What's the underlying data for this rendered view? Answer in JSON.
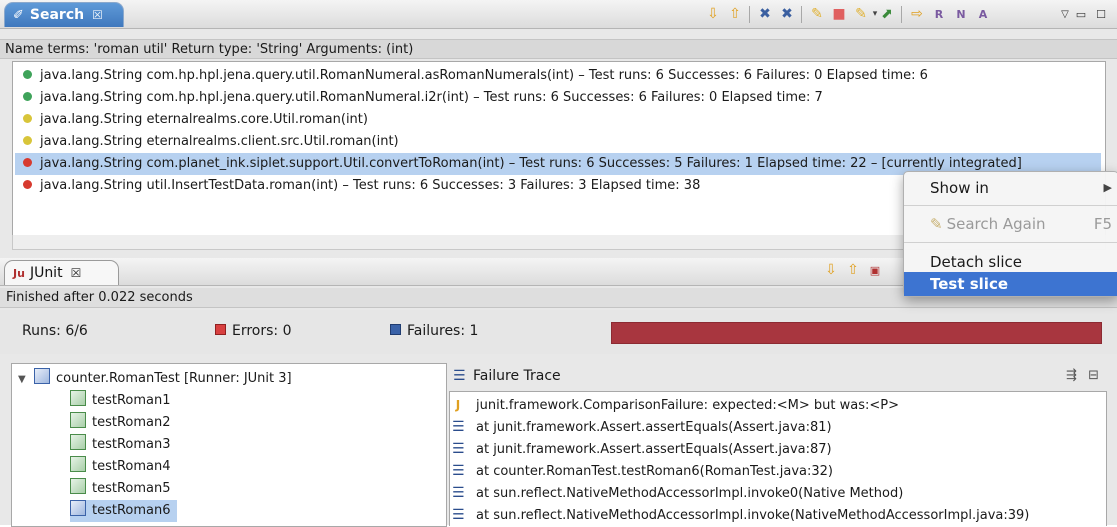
{
  "search_view": {
    "tab_label": "Search",
    "tab_close": "☒",
    "status": "Name terms: 'roman util' Return type: 'String' Arguments: (int)",
    "results": [
      {
        "text": "java.lang.String com.hp.hpl.jena.query.util.RomanNumeral.asRomanNumerals(int) – Test runs: 6 Successes: 6 Failures: 0 Elapsed time: 6",
        "status_color": "#3fa35a"
      },
      {
        "text": "java.lang.String com.hp.hpl.jena.query.util.RomanNumeral.i2r(int) – Test runs: 6 Successes: 6 Failures: 0 Elapsed time: 7",
        "status_color": "#3fa35a"
      },
      {
        "text": "java.lang.String eternalrealms.core.Util.roman(int)",
        "status_color": "#d8c53a"
      },
      {
        "text": "java.lang.String eternalrealms.client.src.Util.roman(int)",
        "status_color": "#d8c53a"
      },
      {
        "text": "java.lang.String com.planet_ink.siplet.support.Util.convertToRoman(int) – Test runs: 6 Successes: 5 Failures: 1 Elapsed time: 22 – [currently integrated]",
        "status_color": "#d73a2f"
      },
      {
        "text": "java.lang.String util.InsertTestData.roman(int) – Test runs: 6 Successes: 3 Failures: 3 Elapsed time: 38",
        "status_color": "#d73a2f"
      }
    ],
    "toolbar_icons": [
      "arrow-down-icon",
      "arrow-up-icon",
      "remove-icon",
      "remove-all-icon",
      "search-again-icon",
      "stop-icon",
      "history-icon",
      "pin-icon",
      "forward-icon",
      "filter-r-icon",
      "filter-n-icon",
      "filter-a-icon",
      "view-menu-icon",
      "minimize-icon",
      "maximize-icon"
    ]
  },
  "junit_view": {
    "tab_label": "JUnit",
    "tab_close": "☒",
    "status": "Finished after 0.022 seconds",
    "runs_label": "Runs:",
    "runs_value": "6/6",
    "errors_label": "Errors:",
    "errors_value": "0",
    "failures_label": "Failures:",
    "failures_value": "1",
    "progress_color": "#a8363f",
    "progress_fraction": 1.0,
    "tree": {
      "root": "counter.RomanTest [Runner: JUnit 3]",
      "items": [
        "testRoman1",
        "testRoman2",
        "testRoman3",
        "testRoman4",
        "testRoman5",
        "testRoman6"
      ],
      "selected": "testRoman6"
    },
    "trace": {
      "header": "Failure Trace",
      "lines": [
        "junit.framework.ComparisonFailure: expected:<M> but was:<P>",
        "at junit.framework.Assert.assertEquals(Assert.java:81)",
        "at junit.framework.Assert.assertEquals(Assert.java:87)",
        "at counter.RomanTest.testRoman6(RomanTest.java:32)",
        "at sun.reflect.NativeMethodAccessorImpl.invoke0(Native Method)",
        "at sun.reflect.NativeMethodAccessorImpl.invoke(NativeMethodAccessorImpl.java:39)"
      ]
    }
  },
  "context_menu": {
    "show_in": "Show in",
    "search_again": "Search Again",
    "search_again_shortcut": "F5",
    "detach_slice": "Detach slice",
    "test_slice": "Test slice"
  }
}
